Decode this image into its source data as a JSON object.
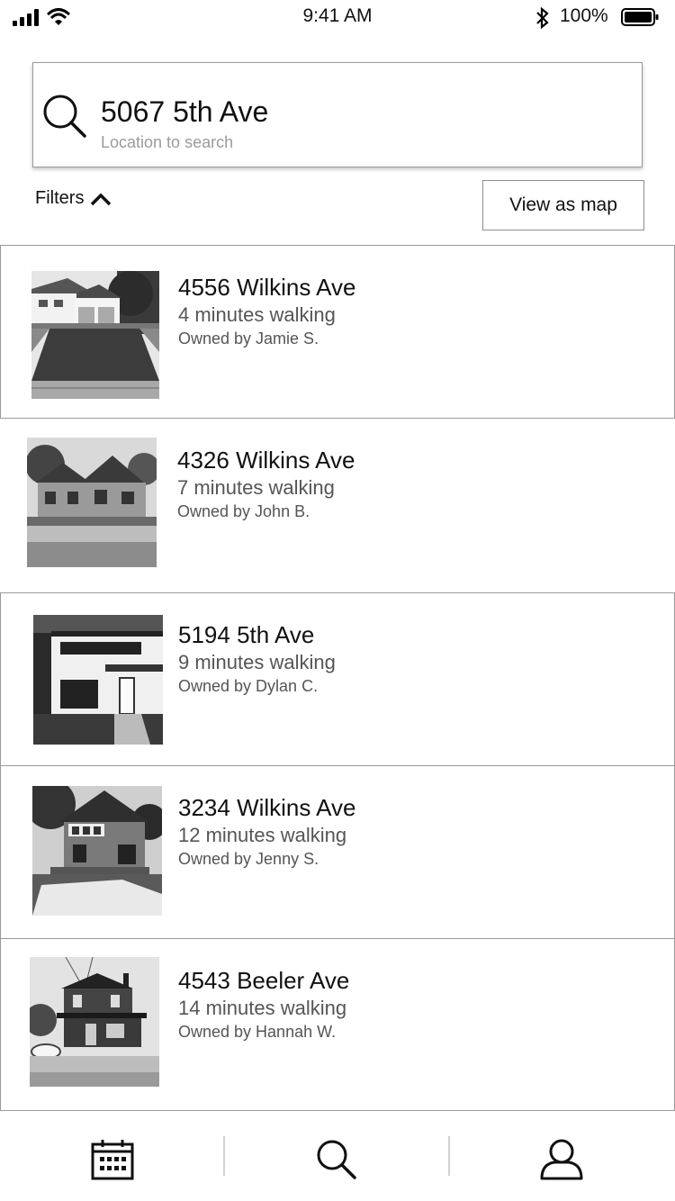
{
  "status_bar": {
    "time": "9:41 AM",
    "battery_percent": "100%",
    "signal_bars": 4,
    "battery_level": 1.0
  },
  "search": {
    "value": "5067 5th Ave",
    "placeholder": "Location to search"
  },
  "filters": {
    "label": "Filters"
  },
  "map_button": {
    "label": "View as map"
  },
  "listings": [
    {
      "address": "4556 Wilkins Ave",
      "walk": "4 minutes walking",
      "owner": "Owned by Jamie S."
    },
    {
      "address": "4326 Wilkins Ave",
      "walk": "7 minutes walking",
      "owner": "Owned by John B."
    },
    {
      "address": "5194 5th Ave",
      "walk": "9 minutes walking",
      "owner": "Owned by Dylan C."
    },
    {
      "address": "3234 Wilkins Ave",
      "walk": "12 minutes walking",
      "owner": "Owned by Jenny S."
    },
    {
      "address": "4543 Beeler Ave",
      "walk": "14 minutes walking",
      "owner": "Owned by Hannah W."
    }
  ],
  "tabbar": {
    "tabs": [
      {
        "icon": "calendar-icon"
      },
      {
        "icon": "search-icon"
      },
      {
        "icon": "profile-icon"
      }
    ]
  }
}
